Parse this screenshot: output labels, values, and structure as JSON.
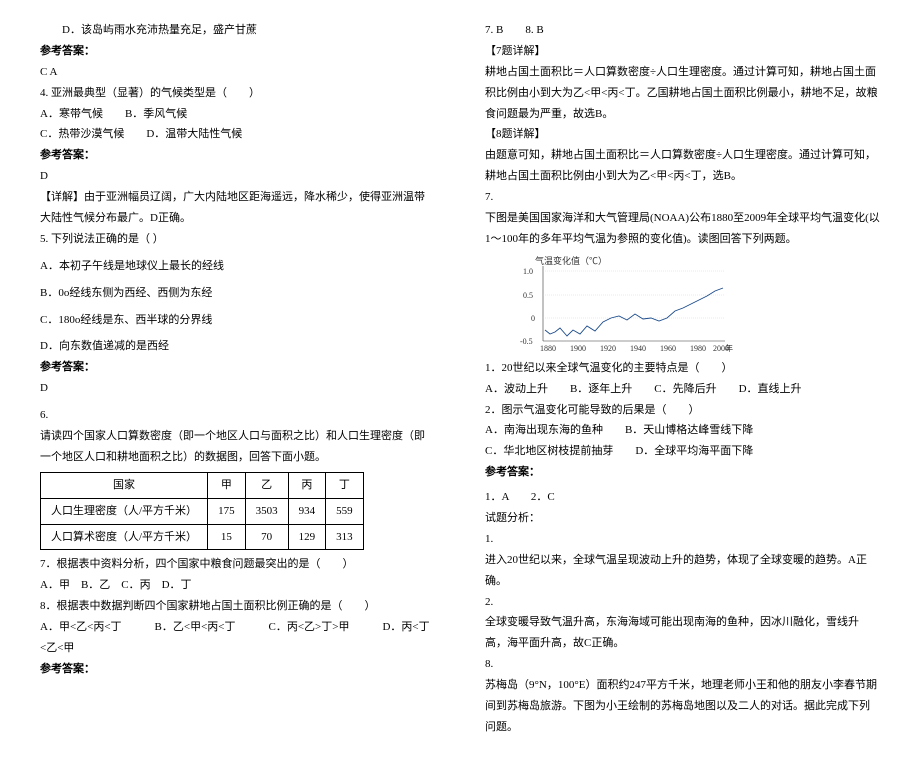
{
  "left": {
    "q3d": "D．该岛屿雨水充沛热量充足，盛产甘蔗",
    "ans_label": "参考答案：",
    "ans3": "C A",
    "q4": "4. 亚洲最典型（显著）的气候类型是（　　）",
    "q4a": "A．寒带气候　　B．季风气候",
    "q4c": "C．热带沙漠气候　　D．温带大陆性气候",
    "ans4": "D",
    "exp4": "【详解】由于亚洲幅员辽阔，广大内陆地区距海遥远，降水稀少，使得亚洲温带大陆性气候分布最广。D正确。",
    "q5": "5. 下列说法正确的是（ ）",
    "q5a": "A．本初子午线是地球仪上最长的经线",
    "q5b": "B．0o经线东侧为西经、西侧为东经",
    "q5c": "C．180o经线是东、西半球的分界线",
    "q5d": "D．向东数值递减的是西经",
    "ans5": "D",
    "q6intro": "6.",
    "q6text": "请读四个国家人口算数密度（即一个地区人口与面积之比）和人口生理密度（即一个地区人口和耕地面积之比）的数据图，回答下面小题。",
    "table": {
      "h0": "国家",
      "h1": "甲",
      "h2": "乙",
      "h3": "丙",
      "h4": "丁",
      "r1c0": "人口生理密度（人/平方千米）",
      "r1c1": "175",
      "r1c2": "3503",
      "r1c3": "934",
      "r1c4": "559",
      "r2c0": "人口算术密度（人/平方千米）",
      "r2c1": "15",
      "r2c2": "70",
      "r2c3": "129",
      "r2c4": "313"
    },
    "q7": "7．根据表中资料分析，四个国家中粮食问题最突出的是（　　）",
    "q7opts": "A．甲　B．乙　C．丙　D．丁",
    "q8": "8．根据表中数据判断四个国家耕地占国土面积比例正确的是（　　）",
    "q8opts": "A．甲<乙<丙<丁　　　B．乙<甲<丙<丁　　　C．丙<乙>丁>甲　　　D．丙<丁<乙<甲"
  },
  "right": {
    "ans78": "7. B　　8. B",
    "exp7h": "【7题详解】",
    "exp7": "耕地占国土面积比＝人口算数密度÷人口生理密度。通过计算可知，耕地占国土面积比例由小到大为乙<甲<丙<丁。乙国耕地占国土面积比例最小，耕地不足，故粮食问题最为严重，故选B。",
    "exp8h": "【8题详解】",
    "exp8": "由题意可知，耕地占国土面积比＝人口算数密度÷人口生理密度。通过计算可知，耕地占国土面积比例由小到大为乙<甲<丙<丁，选B。",
    "q7n": "7.",
    "q7text": "下图是美国国家海洋和大气管理局(NOAA)公布1880至2009年全球平均气温变化(以1～100年的多年平均气温为参照的变化值)。读图回答下列两题。",
    "chart_title": "气温变化值（℃）",
    "sub1": "1．20世纪以来全球气温变化的主要特点是（　　）",
    "sub1opts": "A．波动上升　　B．逐年上升　　C．先降后升　　D．直线上升",
    "sub2": "2．图示气温变化可能导致的后果是（　　）",
    "sub2a": "A．南海出现东海的鱼种　　B．天山博格达峰雪线下降",
    "sub2c": "C．华北地区树枝提前抽芽　　D．全球平均海平面下降",
    "ans_label": "参考答案：",
    "ans12": "1．A　　2．C",
    "analysis_h": "试题分析：",
    "a1h": "1.",
    "a1": "进入20世纪以来，全球气温呈现波动上升的趋势，体现了全球变暖的趋势。A正确。",
    "a2h": "2.",
    "a2": "全球变暖导致气温升高，东海海域可能出现南海的鱼种，因冰川融化，雪线升高，海平面升高，故C正确。",
    "q8n": "8.",
    "q8text": "苏梅岛（9°N，100°E）面积约247平方千米，地理老师小王和他的朋友小李春节期间到苏梅岛旅游。下图为小王绘制的苏梅岛地图以及二人的对话。据此完成下列问题。"
  },
  "chart_data": {
    "type": "line",
    "title": "气温变化值（℃）",
    "xlabel": "年",
    "ylabel": "气温变化值（℃）",
    "x_ticks": [
      1880,
      1890,
      1900,
      1910,
      1920,
      1930,
      1940,
      1950,
      1960,
      1970,
      1980,
      1990,
      2000
    ],
    "ylim": [
      -0.5,
      1.0
    ],
    "y_ticks": [
      -0.5,
      0,
      0.5,
      1.0
    ],
    "x": [
      1880,
      1890,
      1900,
      1910,
      1920,
      1930,
      1940,
      1950,
      1960,
      1970,
      1980,
      1990,
      2000,
      2009
    ],
    "values": [
      -0.25,
      -0.3,
      -0.2,
      -0.35,
      -0.2,
      -0.05,
      0.05,
      -0.05,
      0.0,
      -0.05,
      0.15,
      0.3,
      0.45,
      0.6
    ]
  }
}
